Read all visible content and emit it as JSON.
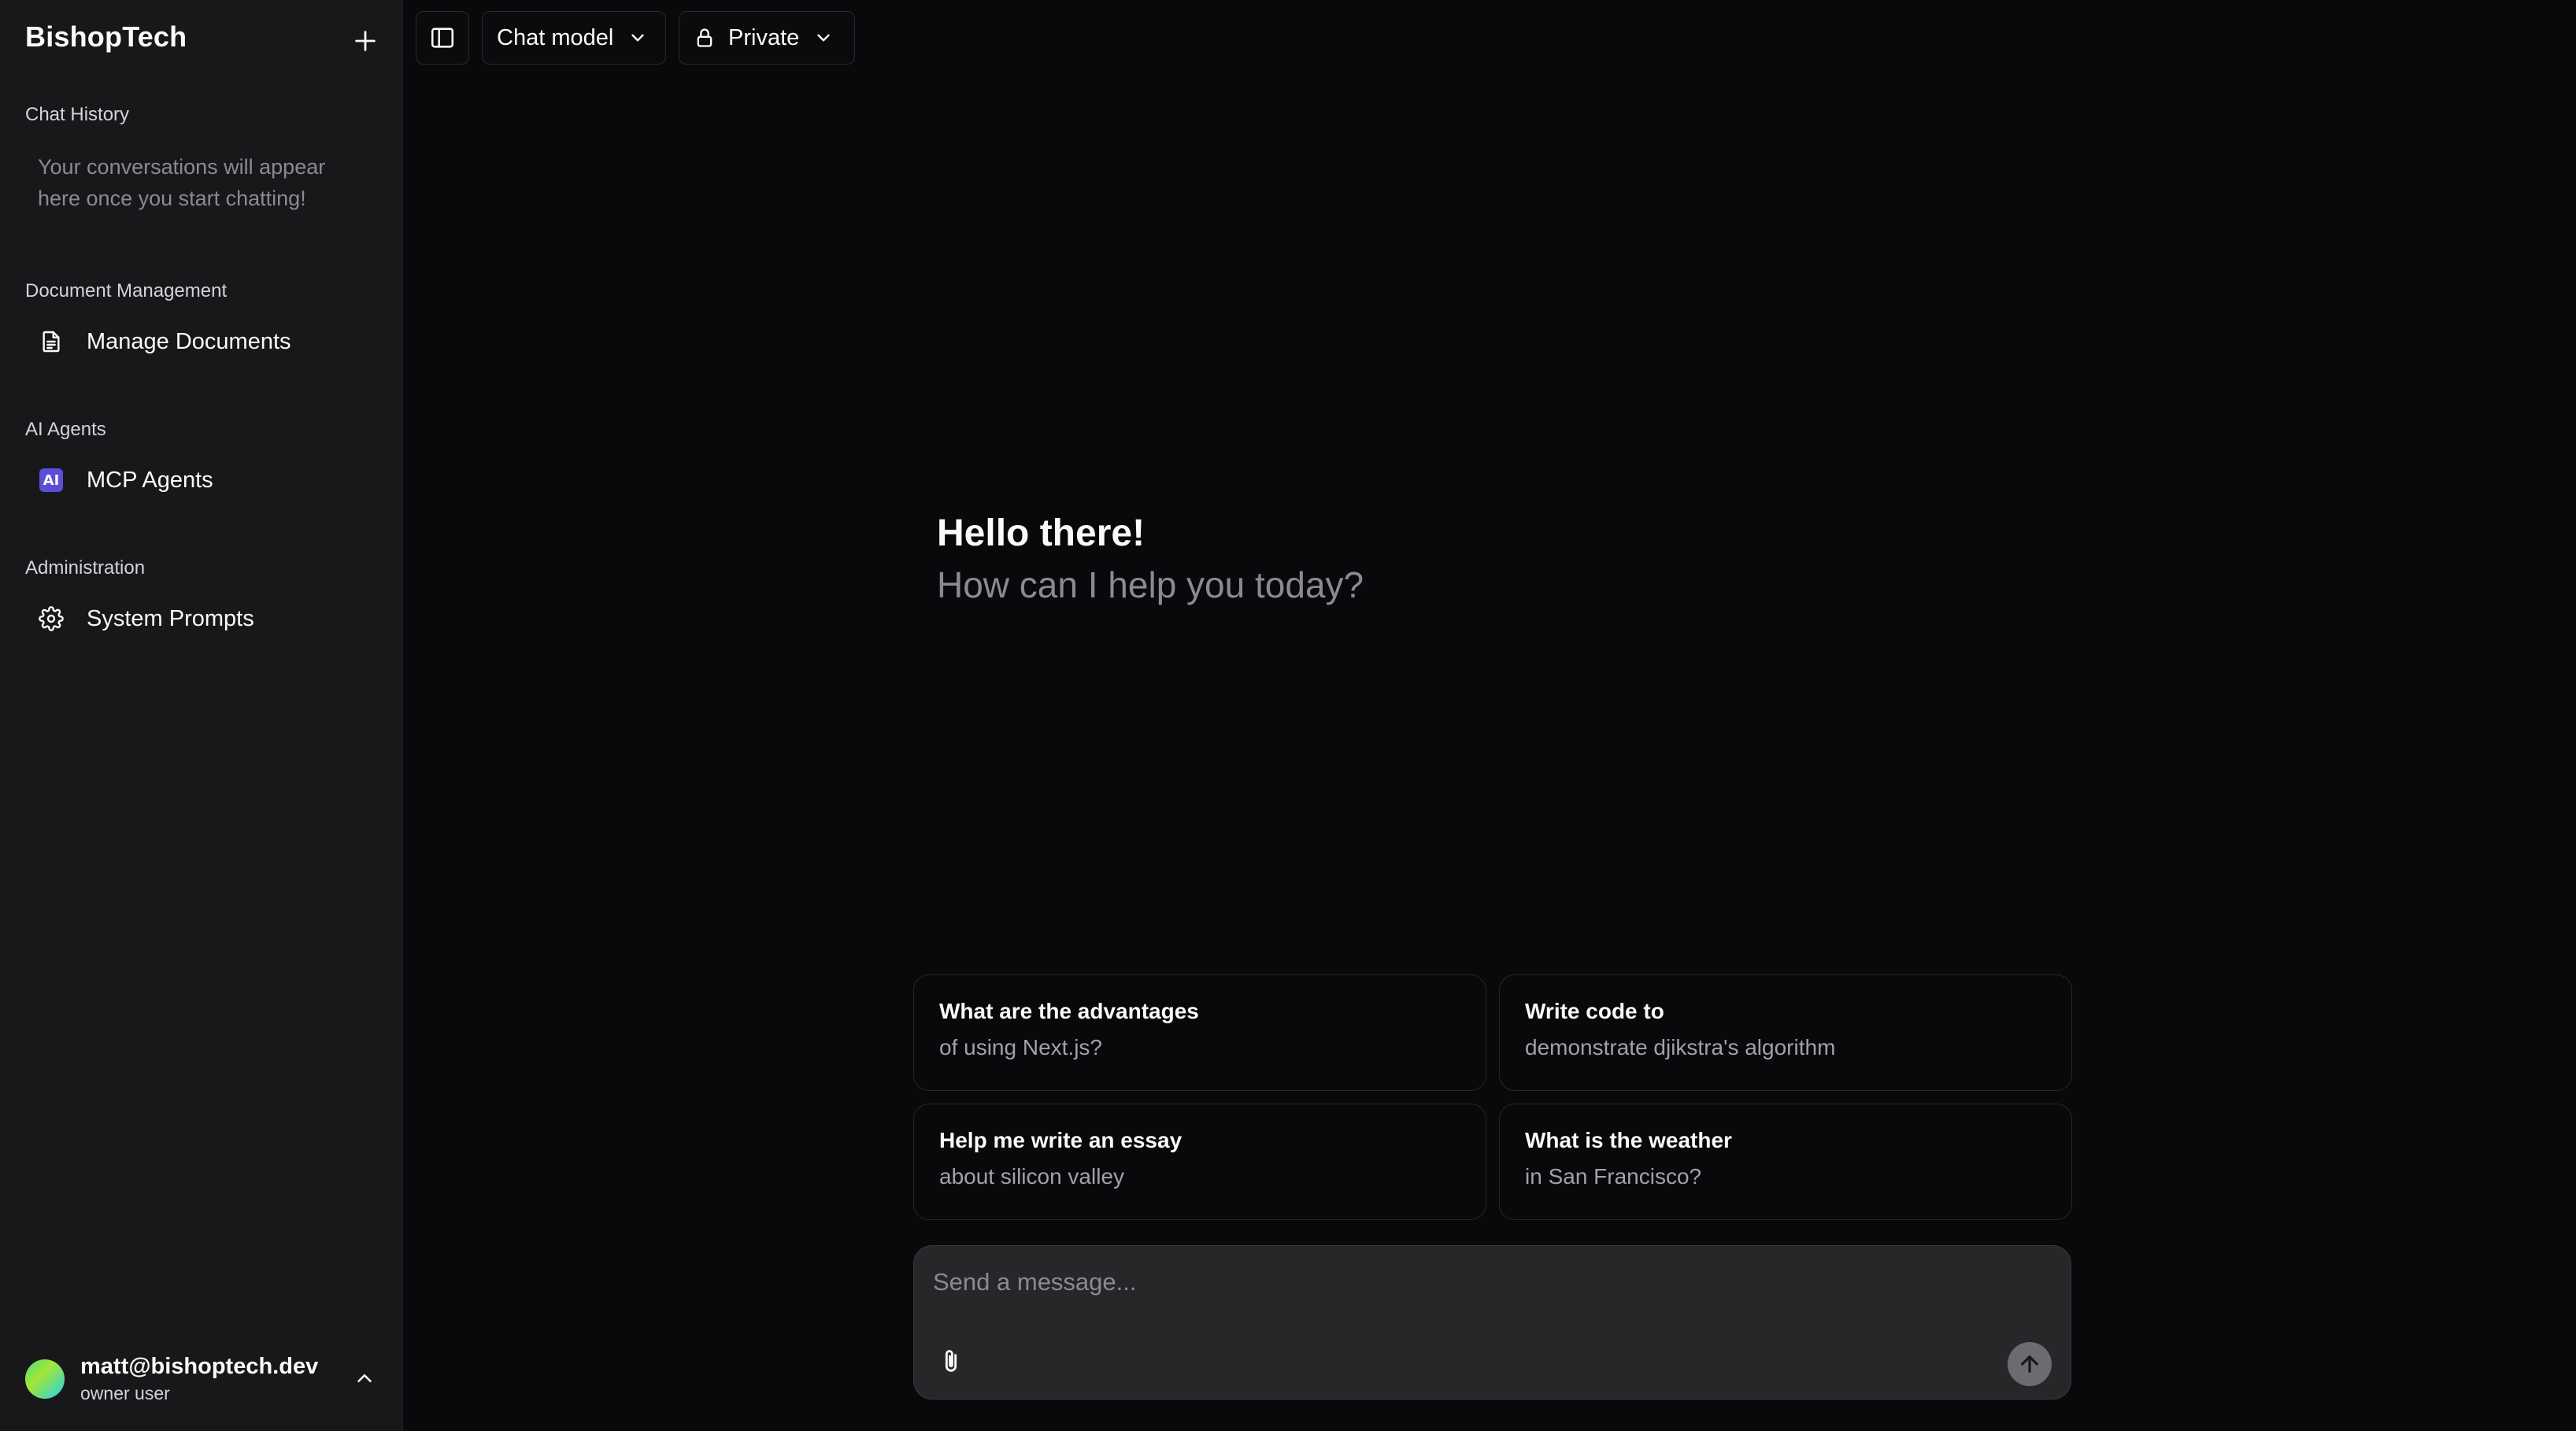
{
  "sidebar": {
    "brand": "BishopTech",
    "sections": {
      "chat_history": "Chat History",
      "document_management": "Document Management",
      "ai_agents": "AI Agents",
      "administration": "Administration"
    },
    "history_empty": "Your conversations will appear here once you start chatting!",
    "items": {
      "manage_documents": "Manage Documents",
      "mcp_agents": "MCP Agents",
      "mcp_agents_badge": "AI",
      "system_prompts": "System Prompts"
    },
    "user": {
      "email": "matt@bishoptech.dev",
      "role": "owner user"
    }
  },
  "toolbar": {
    "model_label": "Chat model",
    "visibility_label": "Private"
  },
  "greeting": {
    "title": "Hello there!",
    "subtitle": "How can I help you today?"
  },
  "suggestions": [
    {
      "title": "What are the advantages",
      "detail": "of using Next.js?"
    },
    {
      "title": "Write code to",
      "detail": "demonstrate djikstra's algorithm"
    },
    {
      "title": "Help me write an essay",
      "detail": "about silicon valley"
    },
    {
      "title": "What is the weather",
      "detail": "in San Francisco?"
    }
  ],
  "composer": {
    "placeholder": "Send a message..."
  },
  "colors": {
    "background": "#09090b",
    "sidebar": "#18181b",
    "accent_badge": "#5b4fd8",
    "send_button": "#6b6b70"
  }
}
